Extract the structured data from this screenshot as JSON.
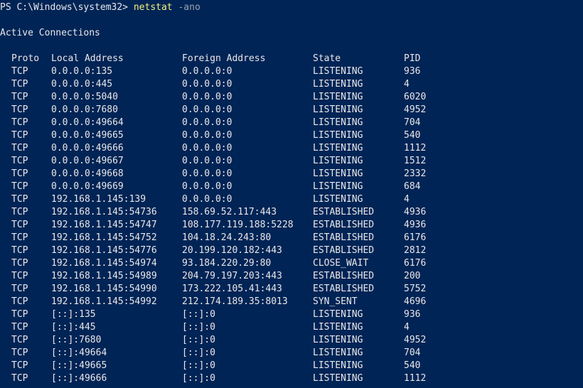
{
  "terminal": {
    "prompt": "PS C:\\Windows\\system32> ",
    "command": "netstat",
    "args": " -ano",
    "section_title": "Active Connections"
  },
  "table": {
    "headers": [
      "Proto",
      "Local Address",
      "Foreign Address",
      "State",
      "PID"
    ],
    "rows": [
      [
        "TCP",
        "0.0.0.0:135",
        "0.0.0.0:0",
        "LISTENING",
        "936"
      ],
      [
        "TCP",
        "0.0.0.0:445",
        "0.0.0.0:0",
        "LISTENING",
        "4"
      ],
      [
        "TCP",
        "0.0.0.0:5040",
        "0.0.0.0:0",
        "LISTENING",
        "6020"
      ],
      [
        "TCP",
        "0.0.0.0:7680",
        "0.0.0.0:0",
        "LISTENING",
        "4952"
      ],
      [
        "TCP",
        "0.0.0.0:49664",
        "0.0.0.0:0",
        "LISTENING",
        "704"
      ],
      [
        "TCP",
        "0.0.0.0:49665",
        "0.0.0.0:0",
        "LISTENING",
        "540"
      ],
      [
        "TCP",
        "0.0.0.0:49666",
        "0.0.0.0:0",
        "LISTENING",
        "1112"
      ],
      [
        "TCP",
        "0.0.0.0:49667",
        "0.0.0.0:0",
        "LISTENING",
        "1512"
      ],
      [
        "TCP",
        "0.0.0.0:49668",
        "0.0.0.0:0",
        "LISTENING",
        "2332"
      ],
      [
        "TCP",
        "0.0.0.0:49669",
        "0.0.0.0:0",
        "LISTENING",
        "684"
      ],
      [
        "TCP",
        "192.168.1.145:139",
        "0.0.0.0:0",
        "LISTENING",
        "4"
      ],
      [
        "TCP",
        "192.168.1.145:54736",
        "158.69.52.117:443",
        "ESTABLISHED",
        "4936"
      ],
      [
        "TCP",
        "192.168.1.145:54747",
        "108.177.119.188:5228",
        "ESTABLISHED",
        "4936"
      ],
      [
        "TCP",
        "192.168.1.145:54752",
        "104.18.24.243:80",
        "ESTABLISHED",
        "6176"
      ],
      [
        "TCP",
        "192.168.1.145:54776",
        "20.199.120.182:443",
        "ESTABLISHED",
        "2812"
      ],
      [
        "TCP",
        "192.168.1.145:54974",
        "93.184.220.29:80",
        "CLOSE_WAIT",
        "6176"
      ],
      [
        "TCP",
        "192.168.1.145:54989",
        "204.79.197.203:443",
        "ESTABLISHED",
        "200"
      ],
      [
        "TCP",
        "192.168.1.145:54990",
        "173.222.105.41:443",
        "ESTABLISHED",
        "5752"
      ],
      [
        "TCP",
        "192.168.1.145:54992",
        "212.174.189.35:8013",
        "SYN_SENT",
        "4696"
      ],
      [
        "TCP",
        "[::]:135",
        "[::]:0",
        "LISTENING",
        "936"
      ],
      [
        "TCP",
        "[::]:445",
        "[::]:0",
        "LISTENING",
        "4"
      ],
      [
        "TCP",
        "[::]:7680",
        "[::]:0",
        "LISTENING",
        "4952"
      ],
      [
        "TCP",
        "[::]:49664",
        "[::]:0",
        "LISTENING",
        "704"
      ],
      [
        "TCP",
        "[::]:49665",
        "[::]:0",
        "LISTENING",
        "540"
      ],
      [
        "TCP",
        "[::]:49666",
        "[::]:0",
        "LISTENING",
        "1112"
      ]
    ]
  },
  "colors": {
    "background": "#012456",
    "text": "#e8e8e8",
    "command": "#f2f27a",
    "argument": "#9aa4b0"
  }
}
